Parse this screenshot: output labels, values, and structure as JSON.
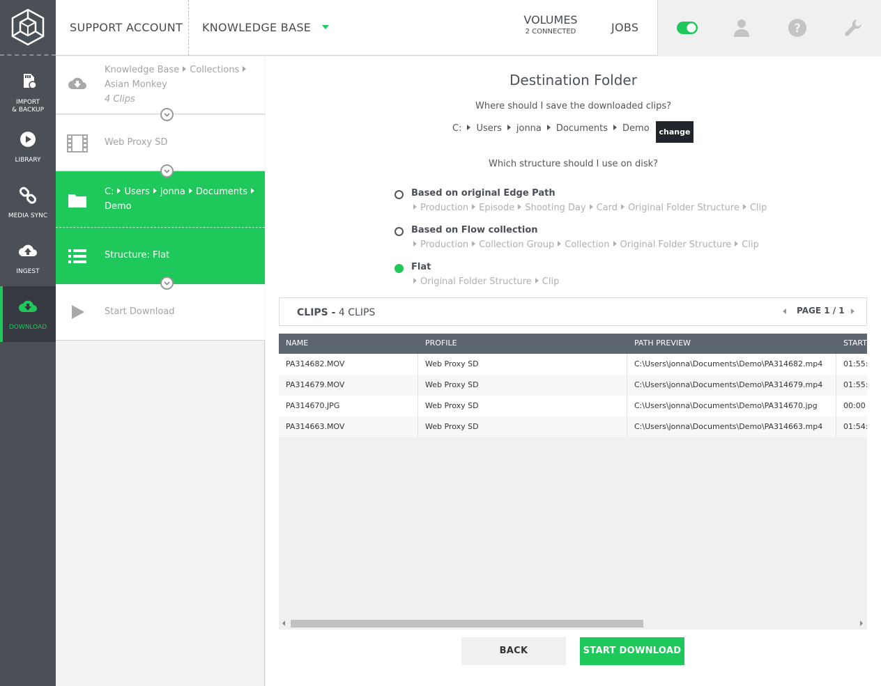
{
  "header": {
    "account": "SUPPORT ACCOUNT",
    "workspace": "KNOWLEDGE BASE",
    "volumes_label": "VOLUMES",
    "volumes_status": "2 CONNECTED",
    "jobs_label": "JOBS",
    "toggle_state": "on"
  },
  "nav": {
    "items": [
      {
        "label_line1": "IMPORT",
        "label_line2": "& BACKUP",
        "icon": "sd-card-icon"
      },
      {
        "label_line1": "LIBRARY",
        "icon": "play-circle-icon"
      },
      {
        "label_line1": "MEDIA SYNC",
        "icon": "link-icon"
      },
      {
        "label_line1": "INGEST",
        "icon": "cloud-upload-icon"
      },
      {
        "label_line1": "DOWNLOAD",
        "icon": "cloud-download-icon",
        "active": true
      }
    ]
  },
  "steps": {
    "source": {
      "crumb1": "Knowledge Base",
      "crumb2": "Collections",
      "crumb3": "Asian Monkey",
      "count": "4 Clips"
    },
    "profile": {
      "label": "Web Proxy SD"
    },
    "destination": {
      "c1": "C:",
      "c2": "Users",
      "c3": "jonna",
      "c4": "Documents",
      "c5": "Demo"
    },
    "structure": {
      "label": "Structure: Flat"
    },
    "start": {
      "label": "Start Download"
    }
  },
  "main": {
    "title": "Destination Folder",
    "save_question": "Where should I save the downloaded clips?",
    "path": [
      "C:",
      "Users",
      "jonna",
      "Documents",
      "Demo"
    ],
    "change_label": "change",
    "structure_question": "Which structure should I use on disk?",
    "options": [
      {
        "label": "Based on original Edge Path",
        "path": [
          "Production",
          "Episode",
          "Shooting Day",
          "Card",
          "Original Folder Structure",
          "Clip"
        ],
        "selected": false
      },
      {
        "label": "Based on Flow collection",
        "path": [
          "Production",
          "Collection Group",
          "Collection",
          "Original Folder Structure",
          "Clip"
        ],
        "selected": false
      },
      {
        "label": "Flat",
        "path": [
          "Original Folder Structure",
          "Clip"
        ],
        "selected": true
      }
    ],
    "clips_label": "CLIPS -",
    "clips_count": "4 CLIPS",
    "page_label": "PAGE 1 / 1"
  },
  "table": {
    "columns": [
      "NAME",
      "PROFILE",
      "PATH PREVIEW",
      "START"
    ],
    "rows": [
      [
        "PA314682.MOV",
        "Web Proxy SD",
        "C:\\Users\\jonna\\Documents\\Demo\\PA314682.mp4",
        "01:55:"
      ],
      [
        "PA314679.MOV",
        "Web Proxy SD",
        "C:\\Users\\jonna\\Documents\\Demo\\PA314679.mp4",
        "01:55:"
      ],
      [
        "PA314670.JPG",
        "Web Proxy SD",
        "C:\\Users\\jonna\\Documents\\Demo\\PA314670.jpg",
        "00:00"
      ],
      [
        "PA314663.MOV",
        "Web Proxy SD",
        "C:\\Users\\jonna\\Documents\\Demo\\PA314663.mp4",
        "01:54:"
      ]
    ]
  },
  "buttons": {
    "back": "BACK",
    "start": "START DOWNLOAD"
  },
  "colors": {
    "accent": "#1ec85a",
    "sidebar": "#4b5057",
    "table_header": "#5d6670"
  }
}
